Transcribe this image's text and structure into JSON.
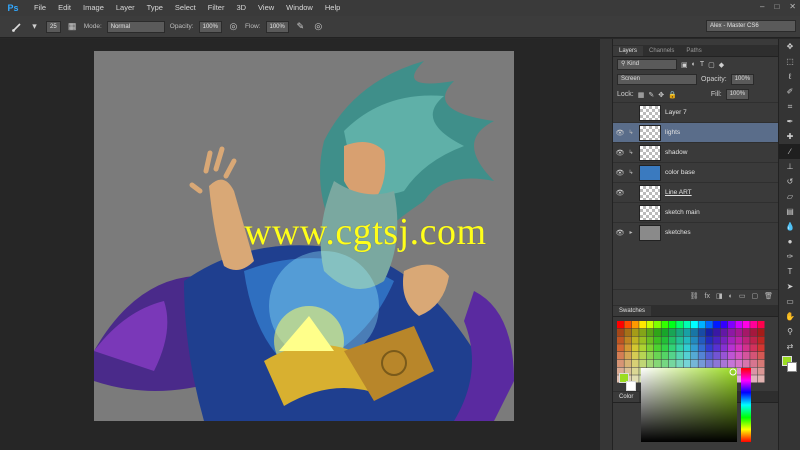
{
  "app": {
    "logo": "Ps"
  },
  "menu": [
    "File",
    "Edit",
    "Image",
    "Layer",
    "Type",
    "Select",
    "Filter",
    "3D",
    "View",
    "Window",
    "Help"
  ],
  "window_controls": [
    "–",
    "□",
    "✕"
  ],
  "options": {
    "brush_size": "25",
    "mode_label": "Mode:",
    "mode_value": "Normal",
    "opacity_label": "Opacity:",
    "opacity_value": "100%",
    "flow_label": "Flow:",
    "flow_value": "100%",
    "workspace": "Alex - Master CS6"
  },
  "watermark": "www.cgtsj.com",
  "layers_panel": {
    "tabs": [
      "Layers",
      "Channels",
      "Paths"
    ],
    "kind_label": "Kind",
    "blend_mode": "Screen",
    "opacity_label": "Opacity:",
    "opacity_value": "100%",
    "lock_label": "Lock:",
    "fill_label": "Fill:",
    "fill_value": "100%",
    "layers": [
      {
        "name": "Layer 7",
        "visible": false
      },
      {
        "name": "lights",
        "visible": true,
        "selected": true
      },
      {
        "name": "shadow",
        "visible": true
      },
      {
        "name": "color base",
        "visible": true
      },
      {
        "name": "Line ART",
        "visible": true
      },
      {
        "name": "sketch main",
        "visible": false
      },
      {
        "name": "sketches",
        "visible": true
      }
    ]
  },
  "swatches_panel": {
    "tab": "Swatches"
  },
  "color_panel": {
    "tab": "Color",
    "foreground": "#9bdc22",
    "background": "#ffffff"
  },
  "tools": [
    "move",
    "marquee",
    "lasso",
    "quick-select",
    "crop",
    "eyedropper",
    "heal",
    "brush",
    "stamp",
    "history-brush",
    "eraser",
    "gradient",
    "blur",
    "dodge",
    "pen",
    "type",
    "path-select",
    "shape",
    "hand",
    "zoom"
  ],
  "colors": {
    "accent": "#31a8ff",
    "selected_layer": "#5a6d8a",
    "watermark": "#ffff1a"
  }
}
